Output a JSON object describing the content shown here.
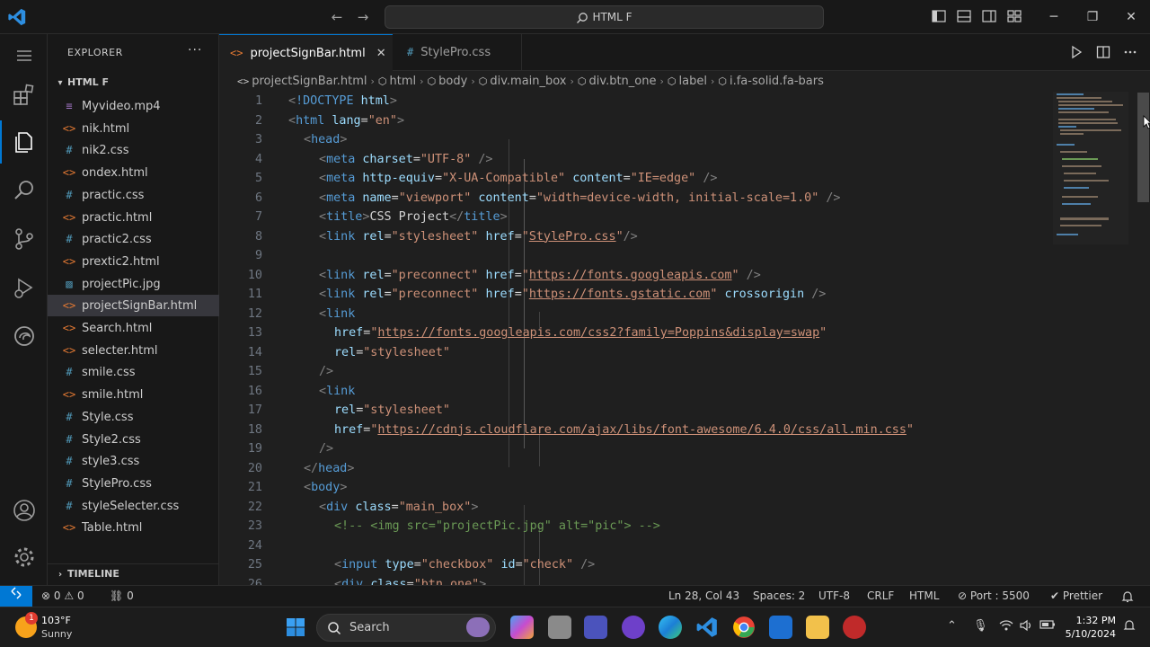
{
  "titlebar": {
    "search_text": "HTML F",
    "back_glyph": "←",
    "forward_glyph": "→",
    "minimize_glyph": "─",
    "restore_glyph": "❐",
    "close_glyph": "✕"
  },
  "sidebar": {
    "title": "EXPLORER",
    "more_glyph": "···",
    "folder_name": "HTML F",
    "timeline": "TIMELINE",
    "files": [
      {
        "name": "Myvideo.mp4",
        "icon": "≡",
        "color": "#a074c4"
      },
      {
        "name": "nik.html",
        "icon": "<>",
        "color": "#e37933"
      },
      {
        "name": "nik2.css",
        "icon": "#",
        "color": "#519aba"
      },
      {
        "name": "ondex.html",
        "icon": "<>",
        "color": "#e37933"
      },
      {
        "name": "practic.css",
        "icon": "#",
        "color": "#519aba"
      },
      {
        "name": "practic.html",
        "icon": "<>",
        "color": "#e37933"
      },
      {
        "name": "practic2.css",
        "icon": "#",
        "color": "#519aba"
      },
      {
        "name": "prextic2.html",
        "icon": "<>",
        "color": "#e37933"
      },
      {
        "name": "projectPic.jpg",
        "icon": "▨",
        "color": "#519aba"
      },
      {
        "name": "projectSignBar.html",
        "icon": "<>",
        "color": "#e37933"
      },
      {
        "name": "Search.html",
        "icon": "<>",
        "color": "#e37933"
      },
      {
        "name": "selecter.html",
        "icon": "<>",
        "color": "#e37933"
      },
      {
        "name": "smile.css",
        "icon": "#",
        "color": "#519aba"
      },
      {
        "name": "smile.html",
        "icon": "<>",
        "color": "#e37933"
      },
      {
        "name": "Style.css",
        "icon": "#",
        "color": "#519aba"
      },
      {
        "name": "Style2.css",
        "icon": "#",
        "color": "#519aba"
      },
      {
        "name": "style3.css",
        "icon": "#",
        "color": "#519aba"
      },
      {
        "name": "StylePro.css",
        "icon": "#",
        "color": "#519aba"
      },
      {
        "name": "styleSelecter.css",
        "icon": "#",
        "color": "#519aba"
      },
      {
        "name": "Table.html",
        "icon": "<>",
        "color": "#e37933"
      }
    ],
    "selected_file": "projectSignBar.html"
  },
  "tabs": [
    {
      "label": "projectSignBar.html",
      "icon": "<>",
      "active": true,
      "close": "✕"
    },
    {
      "label": "StylePro.css",
      "icon": "#",
      "active": false
    }
  ],
  "breadcrumb": [
    {
      "label": "projectSignBar.html",
      "icon": "<>"
    },
    {
      "label": "html",
      "icon": "⬡"
    },
    {
      "label": "body",
      "icon": "⬡"
    },
    {
      "label": "div.main_box",
      "icon": "⬡"
    },
    {
      "label": "div.btn_one",
      "icon": "⬡"
    },
    {
      "label": "label",
      "icon": "⬡"
    },
    {
      "label": "i.fa-solid.fa-bars",
      "icon": "⬡"
    }
  ],
  "code_lines": [
    {
      "n": "1",
      "indent": 0,
      "parts": [
        [
          "p",
          "<"
        ],
        [
          "t",
          "!DOCTYPE"
        ],
        [
          "txt",
          " "
        ],
        [
          "a",
          "html"
        ],
        [
          "p",
          ">"
        ]
      ]
    },
    {
      "n": "2",
      "indent": 0,
      "parts": [
        [
          "p",
          "<"
        ],
        [
          "t",
          "html"
        ],
        [
          "txt",
          " "
        ],
        [
          "a",
          "lang"
        ],
        [
          "txt",
          "="
        ],
        [
          "s",
          "\"en\""
        ],
        [
          "p",
          ">"
        ]
      ]
    },
    {
      "n": "3",
      "indent": 1,
      "parts": [
        [
          "p",
          "<"
        ],
        [
          "t",
          "head"
        ],
        [
          "p",
          ">"
        ]
      ]
    },
    {
      "n": "4",
      "indent": 2,
      "parts": [
        [
          "p",
          "<"
        ],
        [
          "t",
          "meta"
        ],
        [
          "txt",
          " "
        ],
        [
          "a",
          "charset"
        ],
        [
          "txt",
          "="
        ],
        [
          "s",
          "\"UTF-8\""
        ],
        [
          "txt",
          " "
        ],
        [
          "p",
          "/>"
        ]
      ]
    },
    {
      "n": "5",
      "indent": 2,
      "parts": [
        [
          "p",
          "<"
        ],
        [
          "t",
          "meta"
        ],
        [
          "txt",
          " "
        ],
        [
          "a",
          "http-equiv"
        ],
        [
          "txt",
          "="
        ],
        [
          "s",
          "\"X-UA-Compatible\""
        ],
        [
          "txt",
          " "
        ],
        [
          "a",
          "content"
        ],
        [
          "txt",
          "="
        ],
        [
          "s",
          "\"IE=edge\""
        ],
        [
          "txt",
          " "
        ],
        [
          "p",
          "/>"
        ]
      ]
    },
    {
      "n": "6",
      "indent": 2,
      "parts": [
        [
          "p",
          "<"
        ],
        [
          "t",
          "meta"
        ],
        [
          "txt",
          " "
        ],
        [
          "a",
          "name"
        ],
        [
          "txt",
          "="
        ],
        [
          "s",
          "\"viewport\""
        ],
        [
          "txt",
          " "
        ],
        [
          "a",
          "content"
        ],
        [
          "txt",
          "="
        ],
        [
          "s",
          "\"width=device-width, initial-scale=1.0\""
        ],
        [
          "txt",
          " "
        ],
        [
          "p",
          "/>"
        ]
      ]
    },
    {
      "n": "7",
      "indent": 2,
      "parts": [
        [
          "p",
          "<"
        ],
        [
          "t",
          "title"
        ],
        [
          "p",
          ">"
        ],
        [
          "txt",
          "CSS Project"
        ],
        [
          "p",
          "</"
        ],
        [
          "t",
          "title"
        ],
        [
          "p",
          ">"
        ]
      ]
    },
    {
      "n": "8",
      "indent": 2,
      "parts": [
        [
          "p",
          "<"
        ],
        [
          "t",
          "link"
        ],
        [
          "txt",
          " "
        ],
        [
          "a",
          "rel"
        ],
        [
          "txt",
          "="
        ],
        [
          "s",
          "\"stylesheet\""
        ],
        [
          "txt",
          " "
        ],
        [
          "a",
          "href"
        ],
        [
          "txt",
          "="
        ],
        [
          "s",
          "\""
        ],
        [
          "u",
          "StylePro.css"
        ],
        [
          "s",
          "\""
        ],
        [
          "p",
          "/>"
        ]
      ]
    },
    {
      "n": "9",
      "indent": 0,
      "parts": []
    },
    {
      "n": "10",
      "indent": 2,
      "parts": [
        [
          "p",
          "<"
        ],
        [
          "t",
          "link"
        ],
        [
          "txt",
          " "
        ],
        [
          "a",
          "rel"
        ],
        [
          "txt",
          "="
        ],
        [
          "s",
          "\"preconnect\""
        ],
        [
          "txt",
          " "
        ],
        [
          "a",
          "href"
        ],
        [
          "txt",
          "="
        ],
        [
          "s",
          "\""
        ],
        [
          "u",
          "https://fonts.googleapis.com"
        ],
        [
          "s",
          "\""
        ],
        [
          "txt",
          " "
        ],
        [
          "p",
          "/>"
        ]
      ]
    },
    {
      "n": "11",
      "indent": 2,
      "parts": [
        [
          "p",
          "<"
        ],
        [
          "t",
          "link"
        ],
        [
          "txt",
          " "
        ],
        [
          "a",
          "rel"
        ],
        [
          "txt",
          "="
        ],
        [
          "s",
          "\"preconnect\""
        ],
        [
          "txt",
          " "
        ],
        [
          "a",
          "href"
        ],
        [
          "txt",
          "="
        ],
        [
          "s",
          "\""
        ],
        [
          "u",
          "https://fonts.gstatic.com"
        ],
        [
          "s",
          "\""
        ],
        [
          "txt",
          " "
        ],
        [
          "a",
          "crossorigin"
        ],
        [
          "txt",
          " "
        ],
        [
          "p",
          "/>"
        ]
      ]
    },
    {
      "n": "12",
      "indent": 2,
      "parts": [
        [
          "p",
          "<"
        ],
        [
          "t",
          "link"
        ]
      ]
    },
    {
      "n": "13",
      "indent": 3,
      "parts": [
        [
          "a",
          "href"
        ],
        [
          "txt",
          "="
        ],
        [
          "s",
          "\""
        ],
        [
          "u",
          "https://fonts.googleapis.com/css2?family=Poppins&display=swap"
        ],
        [
          "s",
          "\""
        ]
      ]
    },
    {
      "n": "14",
      "indent": 3,
      "parts": [
        [
          "a",
          "rel"
        ],
        [
          "txt",
          "="
        ],
        [
          "s",
          "\"stylesheet\""
        ]
      ]
    },
    {
      "n": "15",
      "indent": 2,
      "parts": [
        [
          "p",
          "/>"
        ]
      ]
    },
    {
      "n": "16",
      "indent": 2,
      "parts": [
        [
          "p",
          "<"
        ],
        [
          "t",
          "link"
        ]
      ]
    },
    {
      "n": "17",
      "indent": 3,
      "parts": [
        [
          "a",
          "rel"
        ],
        [
          "txt",
          "="
        ],
        [
          "s",
          "\"stylesheet\""
        ]
      ]
    },
    {
      "n": "18",
      "indent": 3,
      "parts": [
        [
          "a",
          "href"
        ],
        [
          "txt",
          "="
        ],
        [
          "s",
          "\""
        ],
        [
          "u",
          "https://cdnjs.cloudflare.com/ajax/libs/font-awesome/6.4.0/css/all.min.css"
        ],
        [
          "s",
          "\""
        ]
      ]
    },
    {
      "n": "19",
      "indent": 2,
      "parts": [
        [
          "p",
          "/>"
        ]
      ]
    },
    {
      "n": "20",
      "indent": 1,
      "parts": [
        [
          "p",
          "</"
        ],
        [
          "t",
          "head"
        ],
        [
          "p",
          ">"
        ]
      ]
    },
    {
      "n": "21",
      "indent": 1,
      "parts": [
        [
          "p",
          "<"
        ],
        [
          "t",
          "body"
        ],
        [
          "p",
          ">"
        ]
      ]
    },
    {
      "n": "22",
      "indent": 2,
      "parts": [
        [
          "p",
          "<"
        ],
        [
          "t",
          "div"
        ],
        [
          "txt",
          " "
        ],
        [
          "a",
          "class"
        ],
        [
          "txt",
          "="
        ],
        [
          "s",
          "\"main_box\""
        ],
        [
          "p",
          ">"
        ]
      ]
    },
    {
      "n": "23",
      "indent": 3,
      "parts": [
        [
          "c",
          "<!-- <img src=\"projectPic.jpg\" alt=\"pic\"> -->"
        ]
      ]
    },
    {
      "n": "24",
      "indent": 0,
      "parts": []
    },
    {
      "n": "25",
      "indent": 3,
      "parts": [
        [
          "p",
          "<"
        ],
        [
          "t",
          "input"
        ],
        [
          "txt",
          " "
        ],
        [
          "a",
          "type"
        ],
        [
          "txt",
          "="
        ],
        [
          "s",
          "\"checkbox\""
        ],
        [
          "txt",
          " "
        ],
        [
          "a",
          "id"
        ],
        [
          "txt",
          "="
        ],
        [
          "s",
          "\"check\""
        ],
        [
          "txt",
          " "
        ],
        [
          "p",
          "/>"
        ]
      ]
    },
    {
      "n": "26",
      "indent": 3,
      "parts": [
        [
          "p",
          "<"
        ],
        [
          "t",
          "div"
        ],
        [
          "txt",
          " "
        ],
        [
          "a",
          "class"
        ],
        [
          "txt",
          "="
        ],
        [
          "s",
          "\"btn_one\""
        ],
        [
          "p",
          ">"
        ]
      ]
    }
  ],
  "statusbar": {
    "remote": "⨯",
    "errors": "0",
    "warnings": "0",
    "ports_forwarded": "0",
    "cursor": "Ln 28, Col 43",
    "spaces": "Spaces: 2",
    "encoding": "UTF-8",
    "eol": "CRLF",
    "language": "HTML",
    "port": "Port : 5500",
    "formatter": "Prettier"
  },
  "taskbar": {
    "temperature": "103°F",
    "condition": "Sunny",
    "badge": "1",
    "search_label": "Search",
    "time": "1:32 PM",
    "date": "5/10/2024"
  },
  "colors": {
    "accent": "#0078d4",
    "tag": "#569cd6",
    "attr": "#9cdcfe",
    "string": "#ce9178",
    "comment": "#6a9955"
  }
}
